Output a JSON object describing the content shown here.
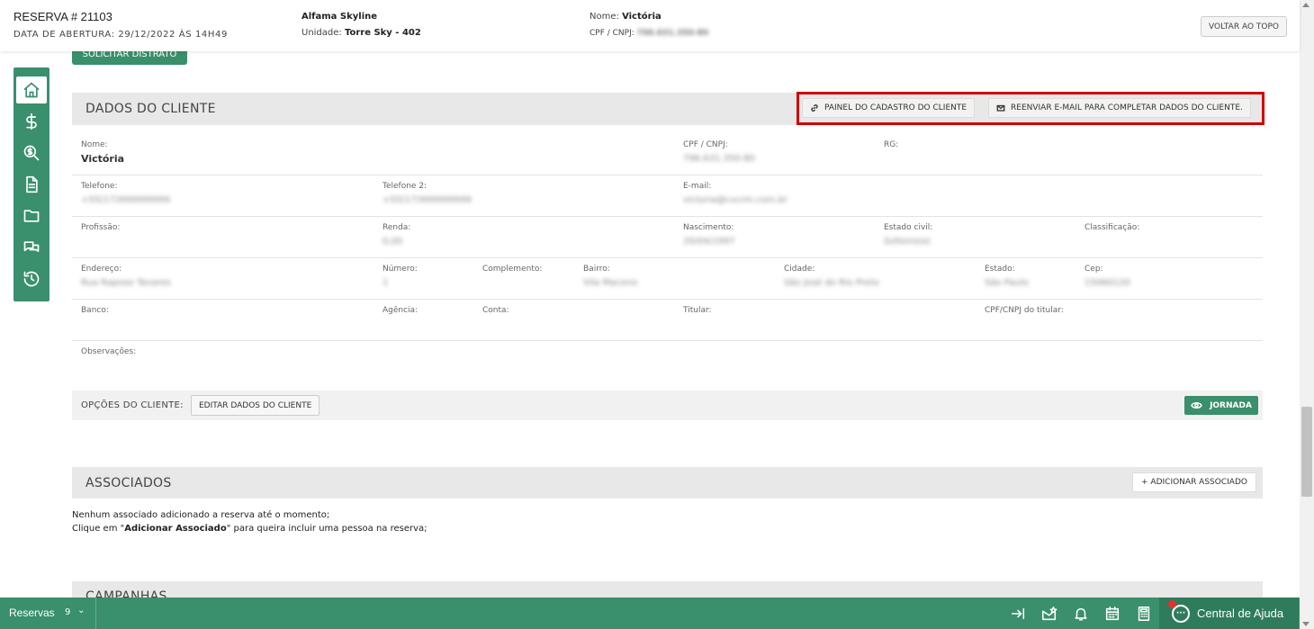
{
  "header": {
    "reserva_title": "RESERVA # 21103",
    "abertura": "DATA DE ABERTURA: 29/12/2022 ÀS 14H49",
    "empreendimento": "Alfama Skyline",
    "unidade_label": "Unidade:",
    "unidade_value": "Torre Sky - 402",
    "nome_label": "Nome:",
    "nome_value": "Victória",
    "cpf_label": "CPF / CNPJ:",
    "cpf_value": "796.631.350-80",
    "back_to_top": "VOLTAR AO TOPO"
  },
  "sidenav": [
    {
      "icon": "home-icon"
    },
    {
      "icon": "dollar-icon"
    },
    {
      "icon": "search-dollar-icon"
    },
    {
      "icon": "document-icon"
    },
    {
      "icon": "folder-icon"
    },
    {
      "icon": "chat-icon"
    },
    {
      "icon": "history-icon"
    }
  ],
  "distrato_button": "SOLICITAR DISTRATO",
  "cliente": {
    "title": "DADOS DO CLIENTE",
    "painel_button": "PAINEL DO CADASTRO DO CLIENTE",
    "reenviar_button": "REENVIAR E-MAIL PARA COMPLETAR DADOS DO CLIENTE.",
    "fields": {
      "nome": {
        "label": "Nome:",
        "value": "Victória"
      },
      "cpf": {
        "label": "CPF / CNPJ:",
        "value": "796.631.350-80"
      },
      "rg": {
        "label": "RG:",
        "value": ""
      },
      "telefone": {
        "label": "Telefone:",
        "value": "+55(17)999999999"
      },
      "telefone2": {
        "label": "Telefone 2:",
        "value": "+55(17)999999999"
      },
      "email": {
        "label": "E-mail:",
        "value": "victoria@cvcrm.com.br"
      },
      "profissao": {
        "label": "Profissão:",
        "value": ""
      },
      "renda": {
        "label": "Renda:",
        "value": "0,00"
      },
      "nascimento": {
        "label": "Nascimento:",
        "value": "20/04/1997"
      },
      "estado_civil": {
        "label": "Estado civil:",
        "value": "Solteiro(a)"
      },
      "classificacao": {
        "label": "Classificação:",
        "value": ""
      },
      "endereco": {
        "label": "Endereço:",
        "value": "Rua Raposo Tavares"
      },
      "numero": {
        "label": "Número:",
        "value": "1"
      },
      "complemento": {
        "label": "Complemento:",
        "value": ""
      },
      "bairro": {
        "label": "Bairro:",
        "value": "Vila Maceno"
      },
      "cidade": {
        "label": "Cidade:",
        "value": "São José do Rio Preto"
      },
      "estado": {
        "label": "Estado:",
        "value": "São Paulo"
      },
      "cep": {
        "label": "Cep:",
        "value": "15060120"
      },
      "banco": {
        "label": "Banco:",
        "value": ""
      },
      "agencia": {
        "label": "Agência:",
        "value": ""
      },
      "conta": {
        "label": "Conta:",
        "value": ""
      },
      "titular": {
        "label": "Titular:",
        "value": ""
      },
      "cpf_titular": {
        "label": "CPF/CNPJ do titular:",
        "value": ""
      },
      "observacoes": {
        "label": "Observações:",
        "value": ""
      }
    },
    "options_label": "OPÇÕES DO CLIENTE:",
    "edit_button": "EDITAR DADOS DO CLIENTE",
    "jornada_button": "JORNADA"
  },
  "associados": {
    "title": "ASSOCIADOS",
    "add_button": "+ ADICIONAR ASSOCIADO",
    "empty_line1": "Nenhum associado adicionado a reserva até o momento;",
    "empty_line2_pre": "Clique em \"",
    "empty_line2_bold": "Adicionar Associado",
    "empty_line2_post": "\" para queira incluir uma pessoa na reserva;"
  },
  "campanhas": {
    "title": "CAMPANHAS"
  },
  "bottombar": {
    "label": "Reservas",
    "count": "9",
    "help_label": "Central de Ajuda"
  }
}
